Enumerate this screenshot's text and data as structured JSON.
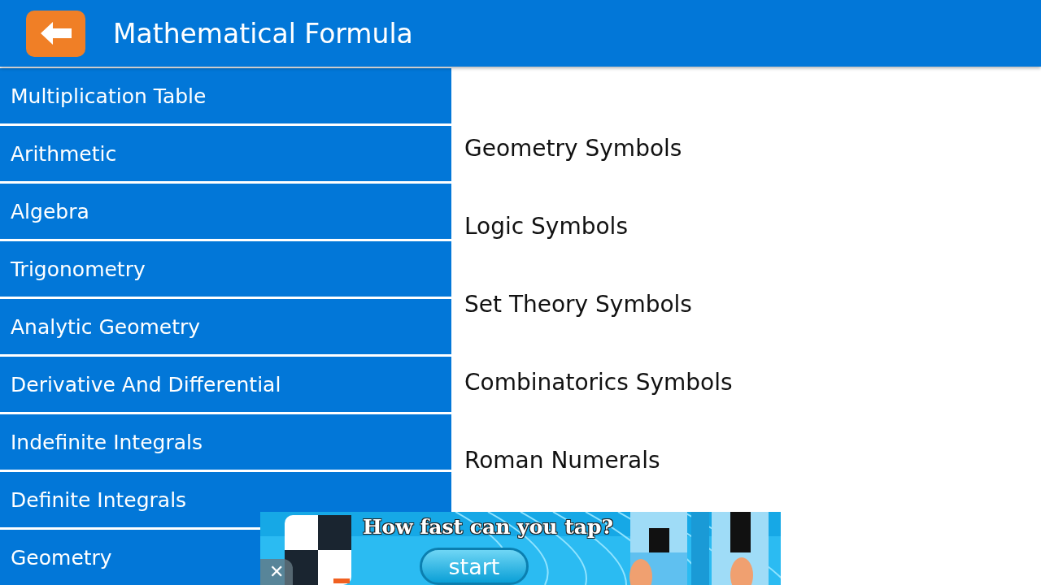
{
  "app_bar": {
    "title": "Mathematical Formula"
  },
  "categories": [
    {
      "label": "Multiplication Table"
    },
    {
      "label": "Arithmetic"
    },
    {
      "label": "Algebra"
    },
    {
      "label": "Trigonometry"
    },
    {
      "label": "Analytic Geometry"
    },
    {
      "label": "Derivative And Differential"
    },
    {
      "label": "Indefinite Integrals"
    },
    {
      "label": "Definite Integrals"
    },
    {
      "label": "Geometry"
    }
  ],
  "topics": [
    {
      "label": "Geometry Symbols"
    },
    {
      "label": "Logic Symbols"
    },
    {
      "label": "Set Theory Symbols"
    },
    {
      "label": "Combinatorics Symbols"
    },
    {
      "label": "Roman Numerals"
    }
  ],
  "ad_banner": {
    "headline": "How fast can you tap?",
    "button": "start",
    "close": "✕"
  }
}
